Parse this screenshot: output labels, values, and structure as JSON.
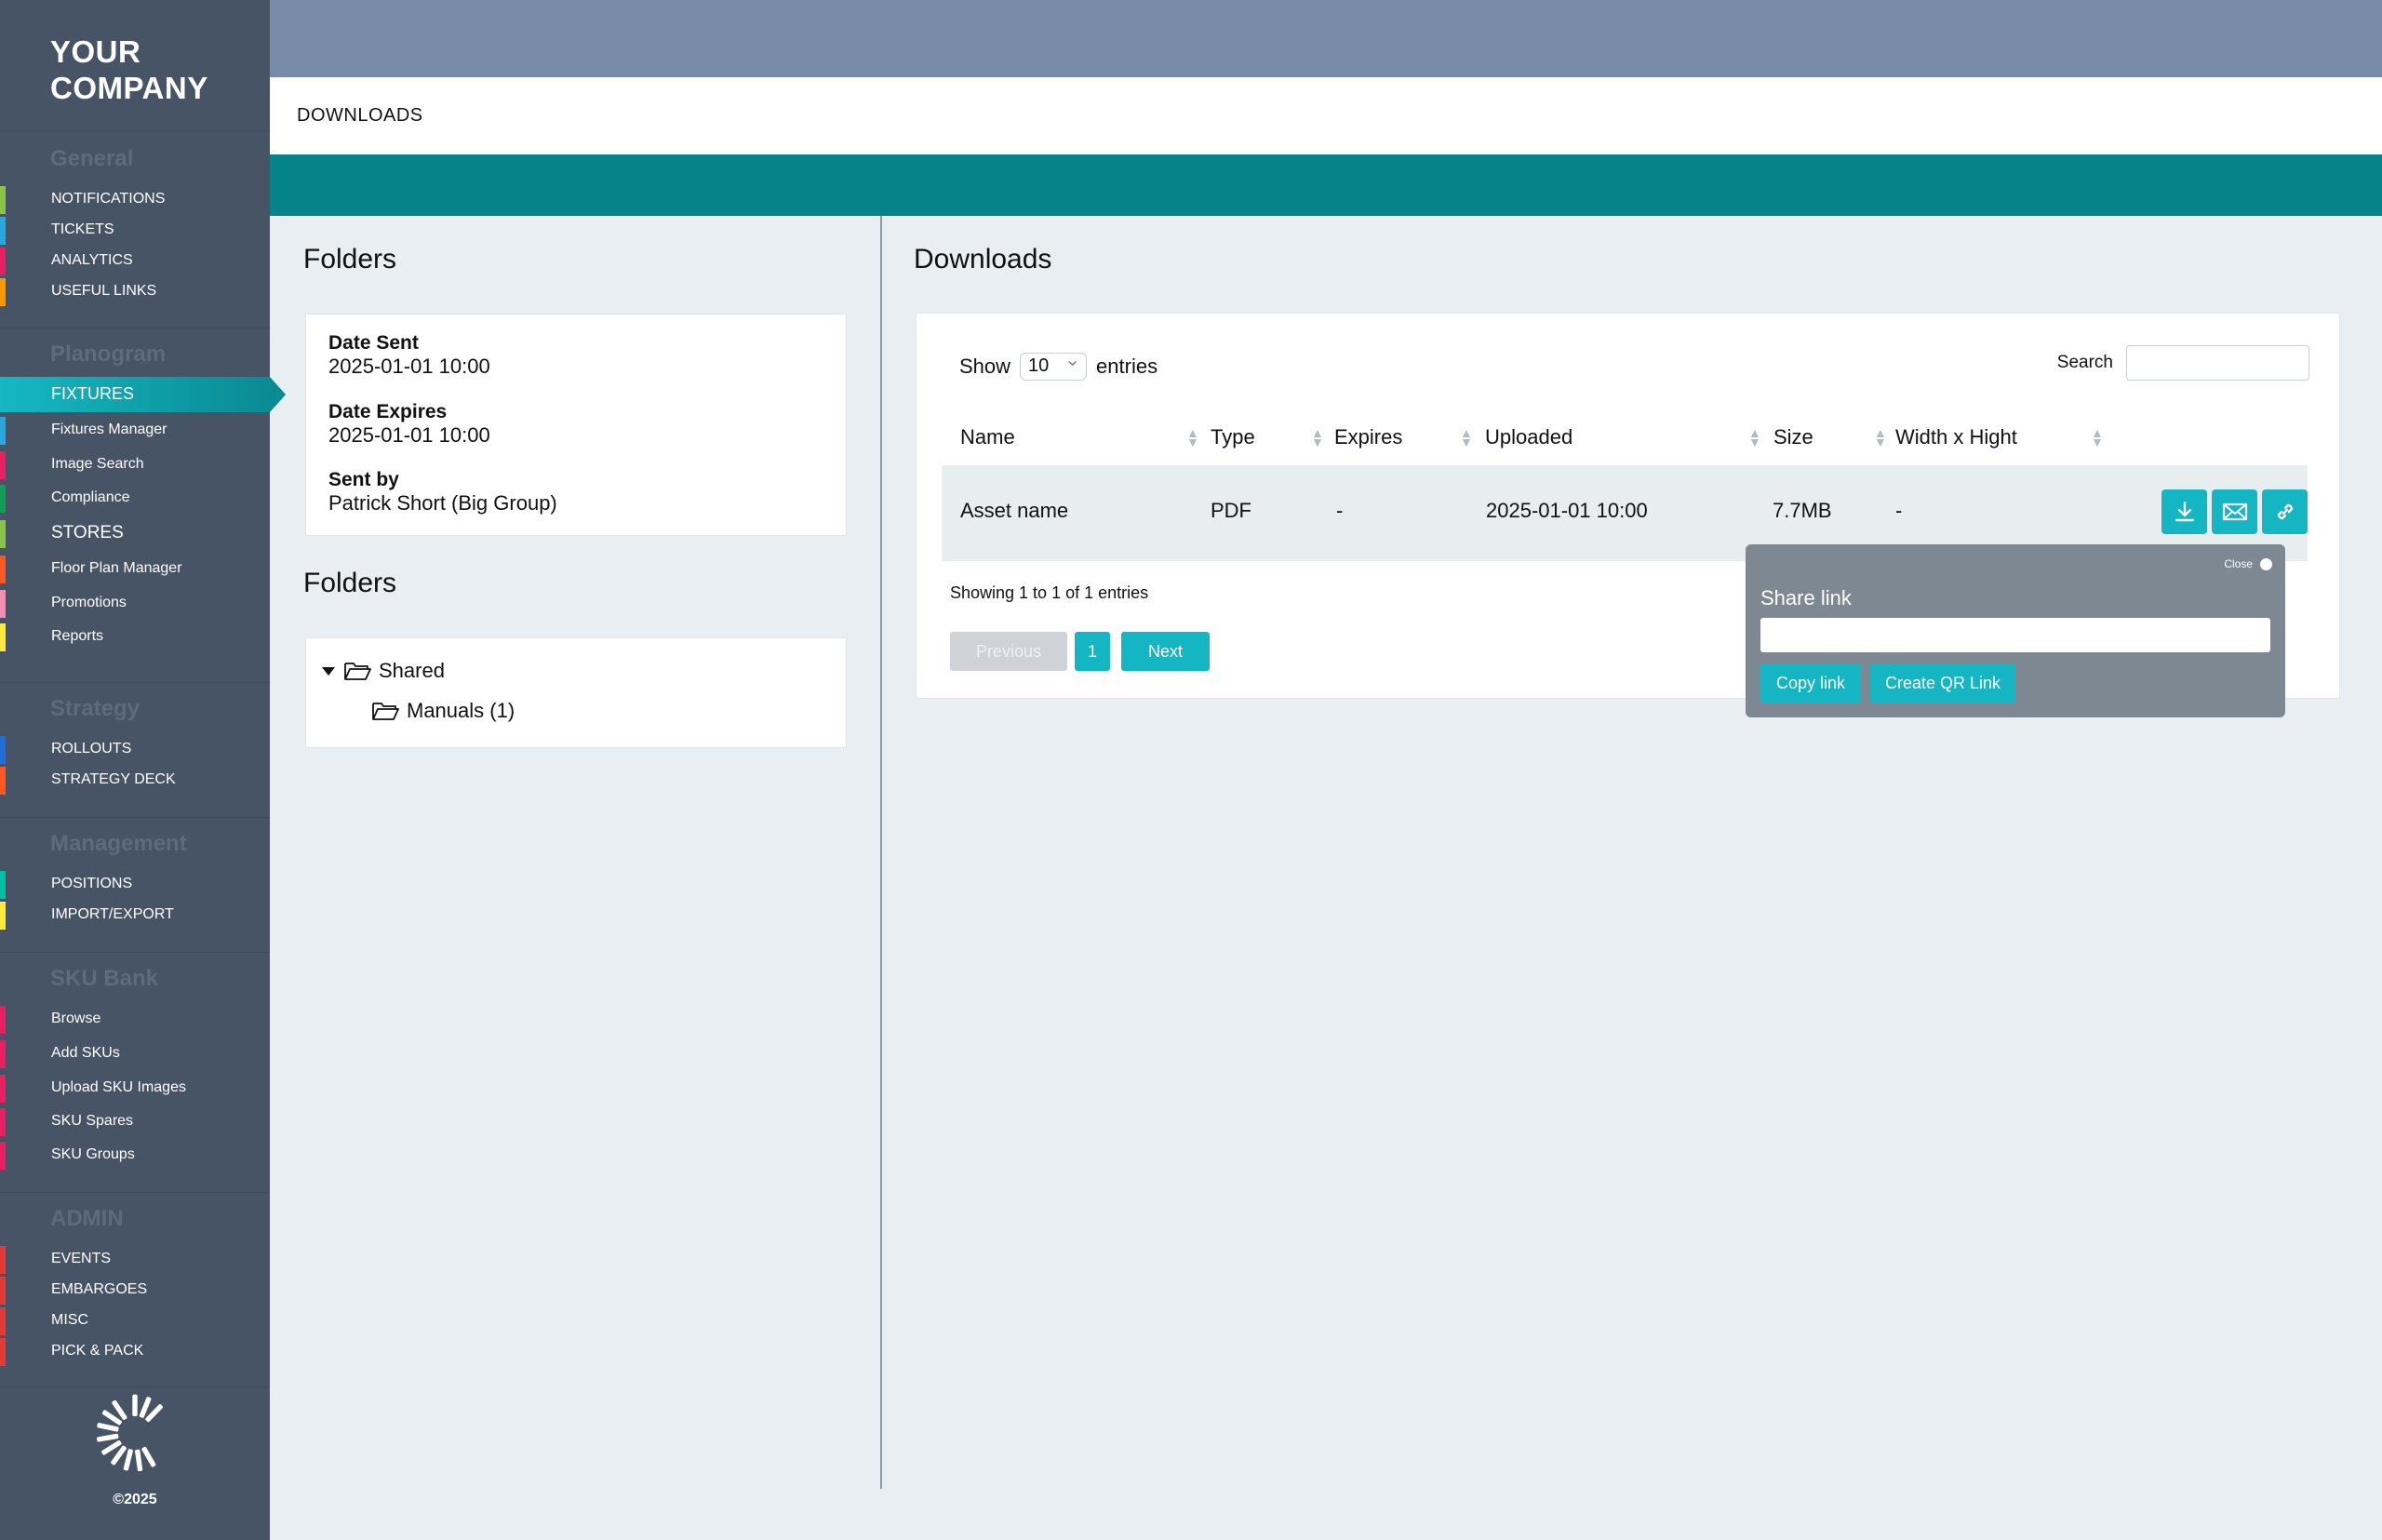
{
  "brand": {
    "line1": "YOUR",
    "line2": "COMPANY",
    "copyright": "©2025"
  },
  "sidebar": {
    "sections": [
      {
        "title": "General",
        "items": [
          {
            "label": "NOTIFICATIONS",
            "color": "#8bc34a"
          },
          {
            "label": "TICKETS",
            "color": "#29a8e0"
          },
          {
            "label": "ANALYTICS",
            "color": "#e91e63"
          },
          {
            "label": "USEFUL LINKS",
            "color": "#ff9800"
          }
        ]
      },
      {
        "title": "Planogram",
        "items": [
          {
            "label": "FIXTURES",
            "color": "#15b8c3",
            "active": true
          },
          {
            "label": "Fixtures Manager",
            "color": "#29a8e0"
          },
          {
            "label": "Image Search",
            "color": "#e91e63"
          },
          {
            "label": "Compliance",
            "color": "#0f9d58"
          },
          {
            "label": "STORES",
            "color": "#8bc34a"
          },
          {
            "label": "Floor Plan Manager",
            "color": "#ff5722"
          },
          {
            "label": "Promotions",
            "color": "#f48fb1"
          },
          {
            "label": "Reports",
            "color": "#ffeb3b"
          }
        ]
      },
      {
        "title": "Strategy",
        "items": [
          {
            "label": "ROLLOUTS",
            "color": "#1e6fd9"
          },
          {
            "label": "STRATEGY DECK",
            "color": "#ff5722"
          }
        ]
      },
      {
        "title": "Management",
        "items": [
          {
            "label": "POSITIONS",
            "color": "#00bfa5"
          },
          {
            "label": "IMPORT/EXPORT",
            "color": "#ffeb3b"
          }
        ]
      },
      {
        "title": "SKU Bank",
        "items": [
          {
            "label": "Browse",
            "color": "#e91e63"
          },
          {
            "label": "Add SKUs",
            "color": "#e91e63"
          },
          {
            "label": "Upload SKU Images",
            "color": "#e91e63"
          },
          {
            "label": "SKU Spares",
            "color": "#e91e63"
          },
          {
            "label": "SKU Groups",
            "color": "#e91e63"
          }
        ]
      },
      {
        "title": "ADMIN",
        "items": [
          {
            "label": "EVENTS",
            "color": "#e53935"
          },
          {
            "label": "EMBARGOES",
            "color": "#e53935"
          },
          {
            "label": "MISC",
            "color": "#e53935"
          },
          {
            "label": "PICK & PACK",
            "color": "#e53935"
          }
        ]
      }
    ]
  },
  "page": {
    "title": "DOWNLOADS"
  },
  "left": {
    "folders_heading": "Folders",
    "meta": {
      "date_sent_label": "Date Sent",
      "date_sent": "2025-01-01 10:00",
      "date_expires_label": "Date Expires",
      "date_expires": "2025-01-01 10:00",
      "sent_by_label": "Sent by",
      "sent_by": "Patrick Short (Big Group)"
    },
    "folders_heading2": "Folders",
    "tree": {
      "root": "Shared",
      "child": "Manuals (1)"
    }
  },
  "right": {
    "heading": "Downloads",
    "show_label": "Show",
    "entries_value": "10",
    "entries_label": "entries",
    "search_label": "Search",
    "columns": [
      "Name",
      "Type",
      "Expires",
      "Uploaded",
      "Size",
      "Width x Hight"
    ],
    "rows": [
      {
        "name": "Asset name",
        "type": "PDF",
        "expires": "-",
        "uploaded": "2025-01-01 10:00",
        "size": "7.7MB",
        "dims": "-"
      }
    ],
    "info": "Showing 1 to 1 of 1 entries",
    "pagination": {
      "previous": "Previous",
      "page": "1",
      "next": "Next"
    }
  },
  "share_popover": {
    "close": "Close",
    "label": "Share link",
    "value": "",
    "copy": "Copy link",
    "qr": "Create QR Link"
  },
  "icons": {
    "download": "download-icon",
    "email": "email-icon",
    "link": "link-icon"
  }
}
